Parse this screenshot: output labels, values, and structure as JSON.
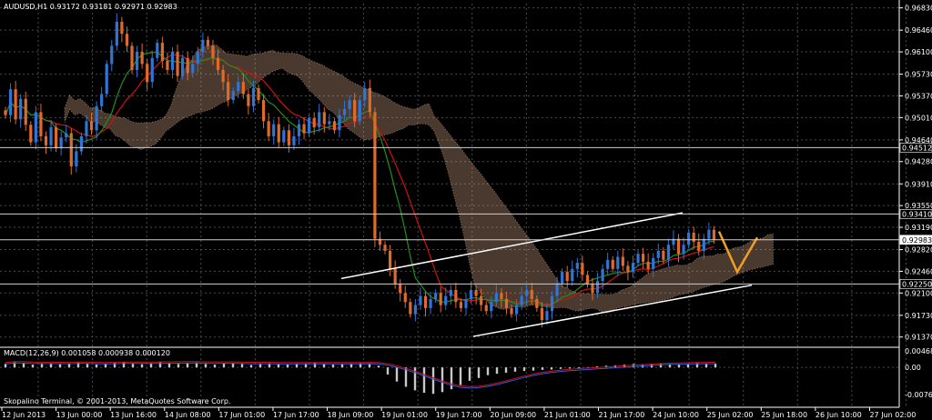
{
  "chart_data": {
    "type": "candlestick",
    "title": "AUDUSD,H1",
    "ohlc_header": "AUDUSD,H1  0.93172 0.93181 0.92971 0.92983",
    "ohlc": {
      "open": 0.93172,
      "high": 0.93181,
      "low": 0.92971,
      "close": 0.92983
    },
    "ylim": [
      0.9123,
      0.969
    ],
    "y_ticks": [
      "0.96830",
      "0.96460",
      "0.96100",
      "0.95730",
      "0.95370",
      "0.95010",
      "0.94640",
      "0.94280",
      "0.93910",
      "0.93550",
      "0.93190",
      "0.92820",
      "0.92460",
      "0.92100",
      "0.91730",
      "0.91370"
    ],
    "x_ticks": [
      "12 Jun 2013",
      "13 Jun 00:00",
      "13 Jun 16:00",
      "14 Jun 08:00",
      "17 Jun 01:00",
      "17 Jun 17:00",
      "18 Jun 09:00",
      "19 Jun 01:00",
      "19 Jun 17:00",
      "20 Jun 09:00",
      "21 Jun 01:00",
      "21 Jun 17:00",
      "24 Jun 10:00",
      "25 Jun 02:00",
      "25 Jun 18:00",
      "26 Jun 10:00",
      "27 Jun 02:00"
    ],
    "price_levels": [
      {
        "value": 0.94512,
        "label": "0.94512"
      },
      {
        "value": 0.9341,
        "label": "0.93410"
      },
      {
        "value": 0.92983,
        "label": "0.92983",
        "highlight": true
      },
      {
        "value": 0.9225,
        "label": "0.92250"
      }
    ],
    "candles_close": [
      0.9505,
      0.9548,
      0.9498,
      0.9532,
      0.9489,
      0.946,
      0.951,
      0.947,
      0.9455,
      0.9485,
      0.945,
      0.9468,
      0.9475,
      0.942,
      0.9445,
      0.947,
      0.9495,
      0.948,
      0.952,
      0.954,
      0.959,
      0.962,
      0.966,
      0.964,
      0.962,
      0.958,
      0.961,
      0.959,
      0.956,
      0.96,
      0.9625,
      0.9595,
      0.958,
      0.961,
      0.957,
      0.96,
      0.9575,
      0.959,
      0.961,
      0.963,
      0.962,
      0.96,
      0.958,
      0.956,
      0.953,
      0.9545,
      0.956,
      0.954,
      0.952,
      0.955,
      0.953,
      0.9495,
      0.947,
      0.949,
      0.946,
      0.948,
      0.9455,
      0.947,
      0.949,
      0.9475,
      0.95,
      0.9485,
      0.951,
      0.949,
      0.9495,
      0.948,
      0.9505,
      0.9515,
      0.953,
      0.9495,
      0.953,
      0.955,
      0.951,
      0.93,
      0.929,
      0.928,
      0.925,
      0.9225,
      0.921,
      0.9195,
      0.9175,
      0.919,
      0.9205,
      0.9185,
      0.92,
      0.921,
      0.919,
      0.9205,
      0.9215,
      0.9195,
      0.9185,
      0.92,
      0.9215,
      0.9205,
      0.919,
      0.918,
      0.9195,
      0.921,
      0.92,
      0.9185,
      0.9175,
      0.919,
      0.9205,
      0.9215,
      0.92,
      0.9185,
      0.9165,
      0.918,
      0.9205,
      0.9225,
      0.9245,
      0.923,
      0.925,
      0.926,
      0.924,
      0.9225,
      0.921,
      0.923,
      0.925,
      0.9265,
      0.925,
      0.927,
      0.9255,
      0.9245,
      0.926,
      0.9275,
      0.9262,
      0.925,
      0.9268,
      0.928,
      0.9265,
      0.929,
      0.93,
      0.9275,
      0.929,
      0.931,
      0.9295,
      0.928,
      0.93,
      0.9315,
      0.9298
    ],
    "series": [
      {
        "color": "#d01010"
      },
      {
        "color": "#1f8f1f"
      }
    ],
    "macd_label": "MACD(12,26,9) 0.001058 0.000938 0.000120",
    "macd_ticks": [
      "0.004687",
      "0.00",
      "-0.007696"
    ],
    "macd_values": [
      0.001,
      0.0015,
      0.0012,
      0.0008,
      0.001,
      0.0011,
      0.0009,
      0.0012,
      0.0014,
      0.001,
      0.0008,
      0.001,
      0.0013,
      0.0015,
      0.0011,
      0.0009,
      0.0012,
      0.0016,
      0.0013,
      0.001,
      0.0012,
      0.0014,
      0.001,
      0.0008,
      0.0011,
      0.0013,
      0.001,
      0.0007,
      0.001,
      0.0012,
      0.0009,
      0.0008,
      0.001,
      0.0011,
      0.0013,
      0.001,
      0.0008,
      0.0009,
      0.0011,
      0.0012,
      0.001,
      0.0005,
      -0.002,
      -0.004,
      -0.0055,
      -0.0065,
      -0.0072,
      -0.0075,
      -0.007,
      -0.0062,
      -0.005,
      -0.0038,
      -0.003,
      -0.0022,
      -0.0018,
      -0.0015,
      -0.0012,
      -0.001,
      -0.0009,
      -0.0007,
      -0.0006,
      -0.0004,
      -0.0003,
      -0.0002,
      0.0,
      0.0003,
      0.0005,
      0.0006,
      0.0008,
      0.001,
      0.0009,
      0.0011,
      0.0012,
      0.001,
      0.0009,
      0.0011,
      0.0012,
      0.001,
      0.0011
    ]
  },
  "footer_text": "Skopalino Terminal, © 2001-2013, MetaQuotes Software Corp.",
  "colors": {
    "background": "#000000",
    "grid": "#4a4a4a",
    "bull": "#2f75d6",
    "bear": "#e06a2a",
    "ma_fast": "#d01010",
    "ma_slow": "#1f8f1f",
    "cloud": "#d2a384",
    "channel": "#ffffff",
    "projection": "#f0a020",
    "macd_hist": "#c8c8c8",
    "macd_signal_red": "#d01010",
    "macd_signal_blue": "#2a5be0"
  }
}
